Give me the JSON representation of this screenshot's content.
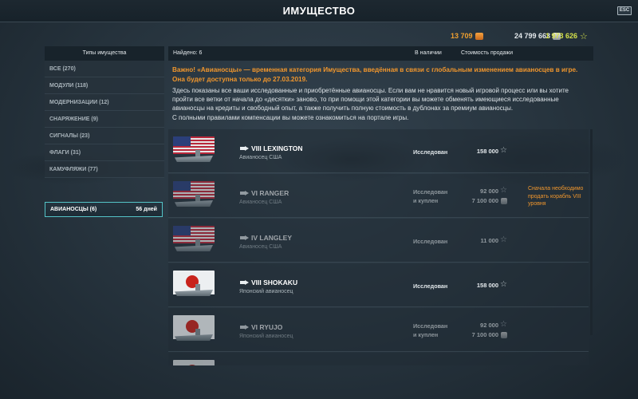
{
  "header": {
    "title": "ИМУЩЕСТВО",
    "esc_label": "ESC"
  },
  "currency": {
    "doubloons": "13 709",
    "credits": "24 799 663",
    "free_xp": "1 973 626",
    "doubloons_icon": "doubloon-icon",
    "credits_icon": "credits-icon",
    "free_xp_icon": "star-icon"
  },
  "sidebar": {
    "header": "Типы имущества",
    "items": [
      {
        "label": "ВСЕ (270)"
      },
      {
        "label": "МОДУЛИ (118)"
      },
      {
        "label": "МОДЕРНИЗАЦИИ (12)"
      },
      {
        "label": "СНАРЯЖЕНИЕ (9)"
      },
      {
        "label": "СИГНАЛЫ (23)"
      },
      {
        "label": "ФЛАГИ (31)"
      },
      {
        "label": "КАМУФЛЯЖИ (77)"
      }
    ],
    "active_item": {
      "label": "АВИАНОСЦЫ (6)",
      "days": "56 дней"
    }
  },
  "main": {
    "found_label": "Найдено: 6",
    "col_available": "В наличии",
    "col_sale_price": "Стоимость продажи",
    "notice": "Важно! «Авианосцы» — временная категория Имущества, введённая в связи с глобальным изменением авианосцев в игре. Она будет доступна только до 27.03.2019.",
    "description": [
      "Здесь показаны все ваши исследованные и приобретённые авианосцы. Если вам не нравится новый игровой процесс или вы хотите",
      "пройти все ветки от начала до «десятки» заново, то при помощи этой категории вы можете обменять имеющиеся исследованные",
      "авианосцы на кредиты и свободный опыт, а также получить полную стоимость в дублонах за премиум авианосцы.",
      "С полными правилами компенсации вы можете ознакомиться на портале игры."
    ],
    "ships": [
      {
        "name": "VIII LEXINGTON",
        "type": "Авианосец США",
        "status": "Исследован",
        "status2": "",
        "xp": "158 000",
        "credits": "",
        "warning": "",
        "flag": "us",
        "faded": false
      },
      {
        "name": "VI RANGER",
        "type": "Авианосец США",
        "status": "Исследован",
        "status2": "и куплен",
        "xp": "92 000",
        "credits": "7 100 000",
        "warning": "Сначала необходимо продать корабль VIII уровня",
        "flag": "us",
        "faded": true
      },
      {
        "name": "IV LANGLEY",
        "type": "Авианосец США",
        "status": "Исследован",
        "status2": "",
        "xp": "11 000",
        "credits": "",
        "warning": "",
        "flag": "us",
        "faded": true
      },
      {
        "name": "VIII SHOKAKU",
        "type": "Японский авианосец",
        "status": "Исследован",
        "status2": "",
        "xp": "158 000",
        "credits": "",
        "warning": "",
        "flag": "jp",
        "faded": false
      },
      {
        "name": "VI RYUJO",
        "type": "Японский авианосец",
        "status": "Исследован",
        "status2": "и куплен",
        "xp": "92 000",
        "credits": "7 100 000",
        "warning": "",
        "flag": "jp",
        "faded": true
      }
    ]
  }
}
